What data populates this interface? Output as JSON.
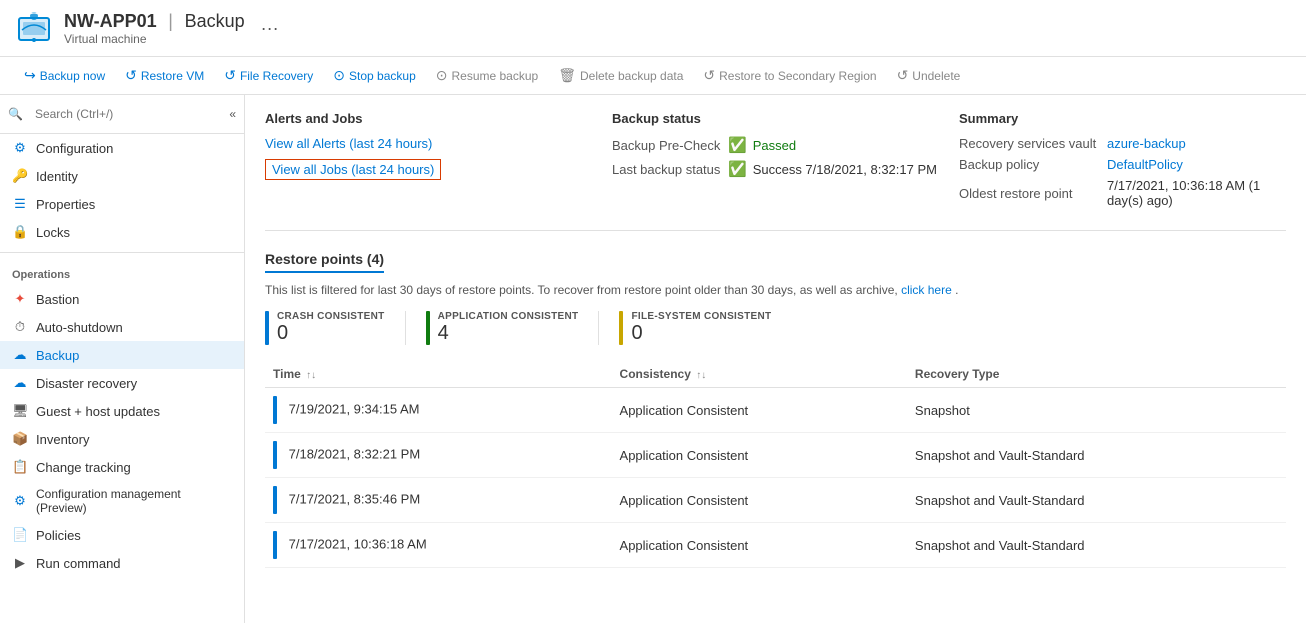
{
  "header": {
    "vm_name": "NW-APP01",
    "separator": "|",
    "page_title": "Backup",
    "subtitle": "Virtual machine",
    "ellipsis": "···"
  },
  "toolbar": {
    "buttons": [
      {
        "id": "backup-now",
        "icon": "↩",
        "label": "Backup now"
      },
      {
        "id": "restore-vm",
        "icon": "↺",
        "label": "Restore VM"
      },
      {
        "id": "file-recovery",
        "icon": "↺",
        "label": "File Recovery"
      },
      {
        "id": "stop-backup",
        "icon": "⊙",
        "label": "Stop backup"
      },
      {
        "id": "resume-backup",
        "icon": "⊙",
        "label": "Resume backup"
      },
      {
        "id": "delete-backup",
        "icon": "🗑",
        "label": "Delete backup data"
      },
      {
        "id": "restore-secondary",
        "icon": "↺",
        "label": "Restore to Secondary Region"
      },
      {
        "id": "undelete",
        "icon": "↺",
        "label": "Undelete"
      }
    ]
  },
  "sidebar": {
    "search_placeholder": "Search (Ctrl+/)",
    "items_top": [
      {
        "id": "configuration",
        "icon": "⚙",
        "label": "Configuration",
        "color": "icon-config"
      },
      {
        "id": "identity",
        "icon": "🔑",
        "label": "Identity",
        "color": "icon-identity"
      },
      {
        "id": "properties",
        "icon": "☰",
        "label": "Properties",
        "color": "icon-props"
      },
      {
        "id": "locks",
        "icon": "🔒",
        "label": "Locks",
        "color": "icon-lock"
      }
    ],
    "group_operations": "Operations",
    "items_operations": [
      {
        "id": "bastion",
        "icon": "✦",
        "label": "Bastion",
        "color": "icon-bastion"
      },
      {
        "id": "auto-shutdown",
        "icon": "⏱",
        "label": "Auto-shutdown",
        "color": "icon-shutdown"
      },
      {
        "id": "backup",
        "icon": "☁",
        "label": "Backup",
        "color": "icon-backup",
        "active": true
      },
      {
        "id": "disaster-recovery",
        "icon": "☁",
        "label": "Disaster recovery",
        "color": "icon-disaster"
      },
      {
        "id": "guest-host-updates",
        "icon": "🖥",
        "label": "Guest + host updates",
        "color": "icon-guest"
      },
      {
        "id": "inventory",
        "icon": "📦",
        "label": "Inventory",
        "color": "icon-inventory"
      },
      {
        "id": "change-tracking",
        "icon": "📋",
        "label": "Change tracking",
        "color": "icon-change"
      },
      {
        "id": "config-management",
        "icon": "⚙",
        "label": "Configuration management (Preview)",
        "color": "icon-confmgmt"
      },
      {
        "id": "policies",
        "icon": "📄",
        "label": "Policies",
        "color": "icon-policies"
      },
      {
        "id": "run-command",
        "icon": "▶",
        "label": "Run command",
        "color": "icon-run"
      }
    ]
  },
  "content": {
    "alerts_jobs": {
      "title": "Alerts and Jobs",
      "link_alerts": "View all Alerts (last 24 hours)",
      "link_jobs": "View all Jobs (last 24 hours)"
    },
    "backup_status": {
      "title": "Backup status",
      "precheck_label": "Backup Pre-Check",
      "precheck_value": "Passed",
      "last_backup_label": "Last backup status",
      "last_backup_value": "Success 7/18/2021, 8:32:17 PM"
    },
    "summary": {
      "title": "Summary",
      "vault_label": "Recovery services vault",
      "vault_value": "azure-backup",
      "policy_label": "Backup policy",
      "policy_value": "DefaultPolicy",
      "oldest_label": "Oldest restore point",
      "oldest_value": "7/17/2021, 10:36:18 AM (1 day(s) ago)"
    },
    "restore_points": {
      "title": "Restore points (4)",
      "description_before": "This list is filtered for last 30 days of restore points. To recover from restore point older than 30 days, as well as archive,",
      "description_link": "click here",
      "description_after": ".",
      "consistency_blocks": [
        {
          "id": "crash",
          "label": "CRASH CONSISTENT",
          "count": "0",
          "color_class": "cc-blue"
        },
        {
          "id": "application",
          "label": "APPLICATION CONSISTENT",
          "count": "4",
          "color_class": "cc-green"
        },
        {
          "id": "filesystem",
          "label": "FILE-SYSTEM CONSISTENT",
          "count": "0",
          "color_class": "cc-yellow"
        }
      ],
      "table_headers": [
        {
          "id": "time",
          "label": "Time",
          "sortable": true
        },
        {
          "id": "consistency",
          "label": "Consistency",
          "sortable": true
        },
        {
          "id": "recovery-type",
          "label": "Recovery Type",
          "sortable": false
        }
      ],
      "table_rows": [
        {
          "time": "7/19/2021, 9:34:15 AM",
          "consistency": "Application Consistent",
          "recovery_type": "Snapshot"
        },
        {
          "time": "7/18/2021, 8:32:21 PM",
          "consistency": "Application Consistent",
          "recovery_type": "Snapshot and Vault-Standard"
        },
        {
          "time": "7/17/2021, 8:35:46 PM",
          "consistency": "Application Consistent",
          "recovery_type": "Snapshot and Vault-Standard"
        },
        {
          "time": "7/17/2021, 10:36:18 AM",
          "consistency": "Application Consistent",
          "recovery_type": "Snapshot and Vault-Standard"
        }
      ]
    }
  }
}
